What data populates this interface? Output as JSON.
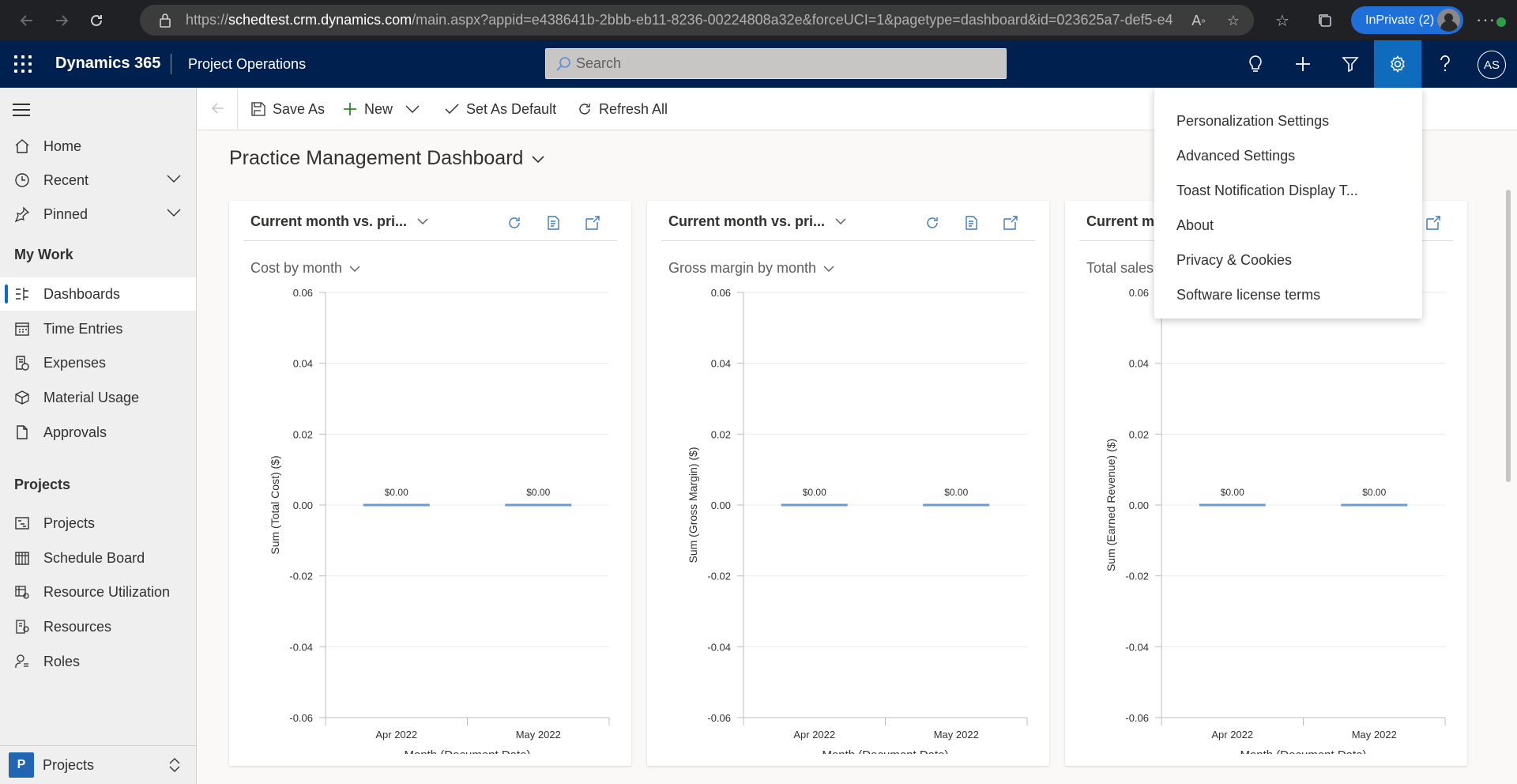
{
  "browser": {
    "url_prefix": "https://",
    "url_host": "schedtest.crm.dynamics.com",
    "url_rest": "/main.aspx?appid=e438641b-2bbb-eb11-8236-00224808a32e&forceUCI=1&pagetype=dashboard&id=023625a7-def5-e41...",
    "inprivate_label": "InPrivate (2)"
  },
  "header": {
    "app_name": "Dynamics 365",
    "module_name": "Project Operations",
    "search_placeholder": "Search",
    "avatar_initials": "AS"
  },
  "sidebar": {
    "top_items": [
      {
        "label": "Home",
        "icon": "home-icon"
      },
      {
        "label": "Recent",
        "icon": "clock-icon"
      },
      {
        "label": "Pinned",
        "icon": "pin-icon"
      }
    ],
    "groups": [
      {
        "title": "My Work",
        "items": [
          {
            "label": "Dashboards",
            "icon": "dashboard-icon",
            "selected": true
          },
          {
            "label": "Time Entries",
            "icon": "calendar-icon"
          },
          {
            "label": "Expenses",
            "icon": "expenses-icon"
          },
          {
            "label": "Material Usage",
            "icon": "cube-icon"
          },
          {
            "label": "Approvals",
            "icon": "approvals-icon"
          }
        ]
      },
      {
        "title": "Projects",
        "items": [
          {
            "label": "Projects",
            "icon": "projects-icon"
          },
          {
            "label": "Schedule Board",
            "icon": "schedule-board-icon"
          },
          {
            "label": "Resource Utilization",
            "icon": "resource-utilization-icon"
          },
          {
            "label": "Resources",
            "icon": "resources-icon"
          },
          {
            "label": "Roles",
            "icon": "roles-icon"
          }
        ]
      }
    ],
    "area": {
      "tile": "P",
      "label": "Projects"
    }
  },
  "commandbar": {
    "save_as": "Save As",
    "new": "New",
    "set_default": "Set As Default",
    "refresh_all": "Refresh All"
  },
  "dashboard": {
    "title": "Practice Management Dashboard",
    "cards": [
      {
        "header": "Current month vs. pri...",
        "subtitle": "Cost by month",
        "ylabel": "Sum (Total Cost) ($)",
        "xlabel": "Month (Document Date)"
      },
      {
        "header": "Current month vs. pri...",
        "subtitle": "Gross margin by month",
        "ylabel": "Sum (Gross Margin) ($)",
        "xlabel": "Month (Document Date)"
      },
      {
        "header": "Current mo",
        "subtitle": "Total sales",
        "ylabel": "Sum (Earned Revenue) ($)",
        "xlabel": "Month (Document Date)"
      }
    ]
  },
  "chart_data": [
    {
      "type": "bar",
      "categories": [
        "Apr 2022",
        "May 2022"
      ],
      "values": [
        0,
        0
      ],
      "data_labels": [
        "$0.00",
        "$0.00"
      ],
      "title": "Cost by month",
      "xlabel": "Month (Document Date)",
      "ylabel": "Sum (Total Cost) ($)",
      "ylim": [
        -0.06,
        0.06
      ],
      "yticks": [
        "0.06",
        "0.04",
        "0.02",
        "0.00",
        "-0.02",
        "-0.04",
        "-0.06"
      ],
      "grid": true,
      "color": "#6b9bd1"
    },
    {
      "type": "bar",
      "categories": [
        "Apr 2022",
        "May 2022"
      ],
      "values": [
        0,
        0
      ],
      "data_labels": [
        "$0.00",
        "$0.00"
      ],
      "title": "Gross margin by month",
      "xlabel": "Month (Document Date)",
      "ylabel": "Sum (Gross Margin) ($)",
      "ylim": [
        -0.06,
        0.06
      ],
      "yticks": [
        "0.06",
        "0.04",
        "0.02",
        "0.00",
        "-0.02",
        "-0.04",
        "-0.06"
      ],
      "grid": true,
      "color": "#6b9bd1"
    },
    {
      "type": "bar",
      "categories": [
        "Apr 2022",
        "May 2022"
      ],
      "values": [
        0,
        0
      ],
      "data_labels": [
        "$0.00",
        "$0.00"
      ],
      "title": "Total sales",
      "xlabel": "Month (Document Date)",
      "ylabel": "Sum (Earned Revenue) ($)",
      "ylim": [
        -0.06,
        0.06
      ],
      "yticks": [
        "0.06",
        "0.04",
        "0.02",
        "0.00",
        "-0.02",
        "-0.04",
        "-0.06"
      ],
      "grid": true,
      "color": "#6b9bd1"
    }
  ],
  "settings_menu": [
    "Personalization Settings",
    "Advanced Settings",
    "Toast Notification Display T...",
    "About",
    "Privacy & Cookies",
    "Software license terms"
  ],
  "colors": {
    "header_bg": "#002050",
    "accent": "#0f6cbd",
    "browser_bg": "#202124"
  }
}
